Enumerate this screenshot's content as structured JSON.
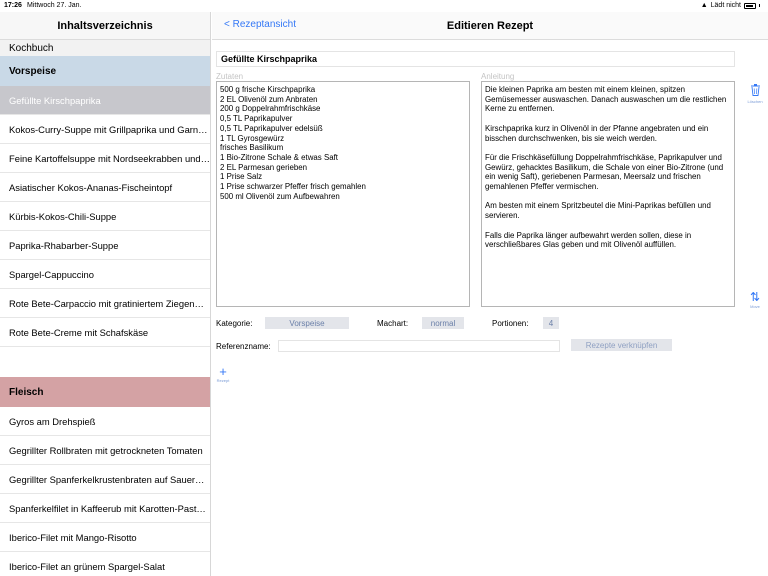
{
  "status": {
    "time": "17:26",
    "date": "Mittwoch 27. Jan.",
    "charging": "Lädt nicht"
  },
  "sidebar": {
    "title": "Inhaltsverzeichnis",
    "book": "Kochbuch",
    "sections": [
      {
        "name": "Vorspeise",
        "items": [
          "Gefüllte Kirschpaprika",
          "Kokos-Curry-Suppe mit Grillpaprika und Garn…",
          "Feine Kartoffelsuppe mit Nordseekrabben und…",
          "Asiatischer Kokos-Ananas-Fischeintopf",
          "Kürbis-Kokos-Chili-Suppe",
          "Paprika-Rhabarber-Suppe",
          "Spargel-Cappuccino",
          "Rote Bete-Carpaccio mit gratiniertem Ziegen…",
          "Rote Bete-Creme mit Schafskäse"
        ]
      },
      {
        "name": "Fleisch",
        "items": [
          "Gyros am Drehspieß",
          "Gegrillter Rollbraten mit getrockneten Tomaten",
          "Gegrillter Spanferkelkrustenbraten auf Sauer…",
          "Spanferkelfilet in Kaffeerub mit Karotten-Past…",
          "Iberico-Filet mit Mango-Risotto",
          "Iberico-Filet an grünem Spargel-Salat"
        ]
      }
    ]
  },
  "main": {
    "back_label": "< Rezeptansicht",
    "title": "Editieren Rezept",
    "recipe_name": "Gefüllte Kirschpaprika",
    "ingredients_label": "Zutaten",
    "instructions_label": "Anleitung",
    "ingredients": "500 g frische Kirschpaprika\n2 EL Olivenöl zum Anbraten\n200 g Doppelrahmfrischkäse\n0,5 TL Paprikapulver\n0,5 TL Paprikapulver edelsüß\n1 TL Gyrosgewürz\nfrisches Basilikum\n1 Bio-Zitrone Schale & etwas Saft\n2 EL Parmesan gerieben\n1 Prise Salz\n1 Prise schwarzer Pfeffer frisch gemahlen\n500 ml Olivenöl zum Aufbewahren",
    "instructions": "Die kleinen Paprika am besten mit einem kleinen, spitzen Gemüsemesser auswaschen. Danach auswaschen um die restlichen Kerne zu entfernen.\n\nKirschpaprika kurz in Olivenöl in der Pfanne angebraten und ein bisschen durchschwenken, bis sie weich werden.\n\nFür die Frischkäsefüllung Doppelrahmfrischkäse, Paprikapulver und Gewürz, gehacktes Basilikum, die Schale von einer Bio-Zitrone (und ein wenig Saft), geriebenen Parmesan, Meersalz und frischen gemahlenen Pfeffer vermischen.\n\nAm besten mit einem Spritzbeutel die Mini-Paprikas befüllen und servieren.\n\nFalls die Paprika länger aufbewahrt werden sollen, diese in verschließbares Glas geben und mit Olivenöl auffüllen.",
    "delete_caption": "Löschen",
    "move_caption": "Move",
    "category_label": "Kategorie:",
    "category_value": "Vorspeise",
    "type_label": "Machart:",
    "type_value": "normal",
    "portions_label": "Portionen:",
    "portions_value": "4",
    "ref_label": "Referenzname:",
    "link_label": "Rezepte verknüpfen",
    "add_caption": "Rezept"
  }
}
